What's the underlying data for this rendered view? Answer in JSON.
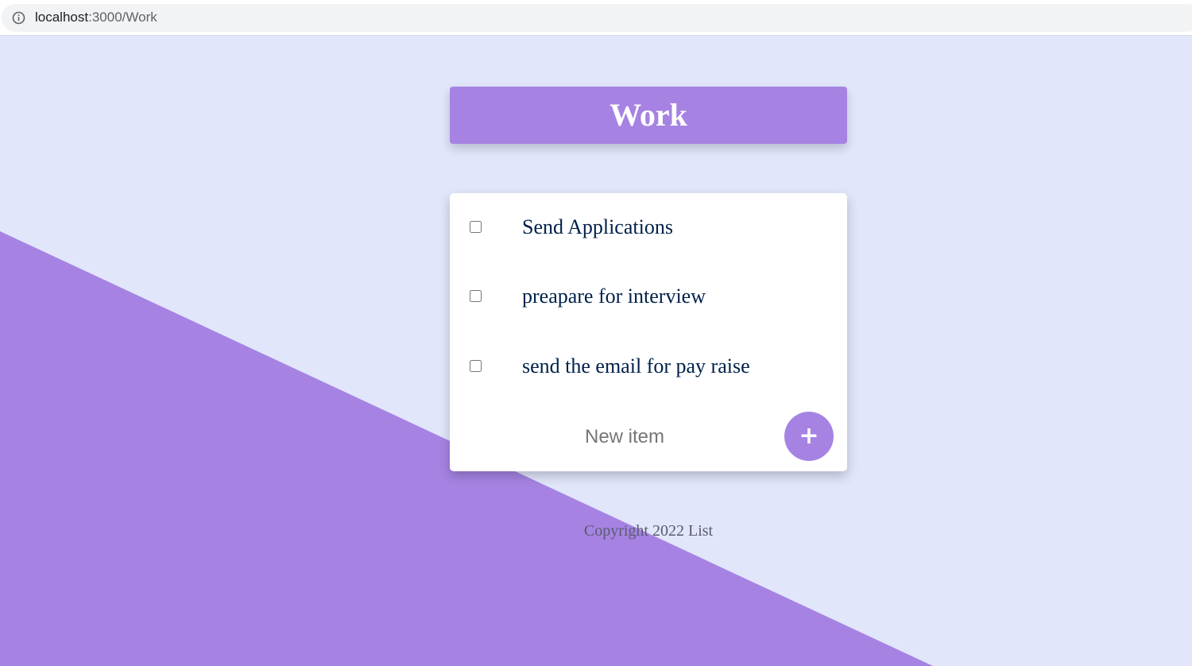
{
  "browser": {
    "url_host": "localhost",
    "url_path": ":3000/Work",
    "info_icon": "info-circle-icon"
  },
  "list": {
    "title": "Work",
    "items": [
      {
        "label": "Send Applications",
        "checked": false
      },
      {
        "label": "preapare for interview",
        "checked": false
      },
      {
        "label": "send the email for pay raise",
        "checked": false
      }
    ],
    "new_item_placeholder": "New item",
    "add_button_label": "+"
  },
  "footer": {
    "text": "Copyright 2022 List"
  },
  "colors": {
    "accent": "#A683E3",
    "background": "#E1E6FB",
    "card": "#FFFFFF",
    "item_text": "#00204A"
  }
}
